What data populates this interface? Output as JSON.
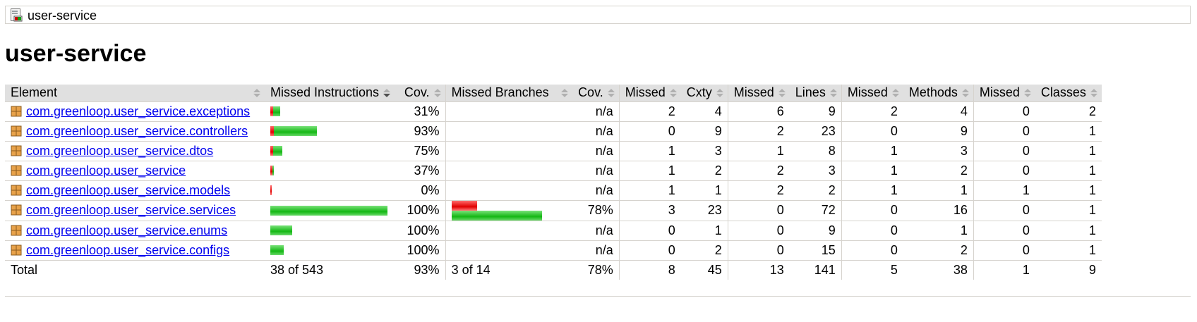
{
  "breadcrumb": {
    "label": "user-service",
    "icon": "report-icon"
  },
  "page_title": "user-service",
  "table": {
    "headers": [
      "Element",
      "Missed Instructions",
      "Cov.",
      "Missed Branches",
      "Cov.",
      "Missed",
      "Cxty",
      "Missed",
      "Lines",
      "Missed",
      "Methods",
      "Missed",
      "Classes"
    ],
    "rows": [
      {
        "name": "com.greenloop.user_service.exceptions",
        "instr_missed_frac": 0.31,
        "instr_cov": "31%",
        "branch_cov": "n/a",
        "cxty_missed": "2",
        "cxty": "4",
        "lines_missed": "6",
        "lines": "9",
        "methods_missed": "2",
        "methods": "4",
        "classes_missed": "0",
        "classes": "2"
      },
      {
        "name": "com.greenloop.user_service.controllers",
        "instr_missed_frac": 0.07,
        "instr_cov": "93%",
        "branch_cov": "n/a",
        "cxty_missed": "0",
        "cxty": "9",
        "lines_missed": "2",
        "lines": "23",
        "methods_missed": "0",
        "methods": "9",
        "classes_missed": "0",
        "classes": "1"
      },
      {
        "name": "com.greenloop.user_service.dtos",
        "instr_missed_frac": 0.25,
        "instr_cov": "75%",
        "branch_cov": "n/a",
        "cxty_missed": "1",
        "cxty": "3",
        "lines_missed": "1",
        "lines": "8",
        "methods_missed": "1",
        "methods": "3",
        "classes_missed": "0",
        "classes": "1"
      },
      {
        "name": "com.greenloop.user_service",
        "instr_missed_frac": 0.63,
        "instr_cov": "37%",
        "branch_cov": "n/a",
        "cxty_missed": "1",
        "cxty": "2",
        "lines_missed": "2",
        "lines": "3",
        "methods_missed": "1",
        "methods": "2",
        "classes_missed": "0",
        "classes": "1"
      },
      {
        "name": "com.greenloop.user_service.models",
        "instr_missed_frac": 1.0,
        "instr_cov": "0%",
        "branch_cov": "n/a",
        "cxty_missed": "1",
        "cxty": "1",
        "lines_missed": "2",
        "lines": "2",
        "methods_missed": "1",
        "methods": "1",
        "classes_missed": "1",
        "classes": "1"
      },
      {
        "name": "com.greenloop.user_service.services",
        "instr_missed_frac": 0.0,
        "instr_cov": "100%",
        "branch_missed_frac": 0.22,
        "branch_cov": "78%",
        "cxty_missed": "3",
        "cxty": "23",
        "lines_missed": "0",
        "lines": "72",
        "methods_missed": "0",
        "methods": "16",
        "classes_missed": "0",
        "classes": "1"
      },
      {
        "name": "com.greenloop.user_service.enums",
        "instr_missed_frac": 0.0,
        "instr_cov": "100%",
        "branch_cov": "n/a",
        "cxty_missed": "0",
        "cxty": "1",
        "lines_missed": "0",
        "lines": "9",
        "methods_missed": "0",
        "methods": "1",
        "classes_missed": "0",
        "classes": "1"
      },
      {
        "name": "com.greenloop.user_service.configs",
        "instr_missed_frac": 0.0,
        "instr_cov": "100%",
        "branch_cov": "n/a",
        "cxty_missed": "0",
        "cxty": "2",
        "lines_missed": "0",
        "lines": "15",
        "methods_missed": "0",
        "methods": "2",
        "classes_missed": "0",
        "classes": "1"
      }
    ],
    "total": {
      "label": "Total",
      "instr": "38 of 543",
      "instr_cov": "93%",
      "branch": "3 of 14",
      "branch_cov": "78%",
      "cxty_missed": "8",
      "cxty": "45",
      "lines_missed": "13",
      "lines": "141",
      "methods_missed": "5",
      "methods": "38",
      "classes_missed": "1",
      "classes": "9"
    }
  },
  "colors": {
    "covered": "#14b814",
    "missed": "#e00000",
    "link": "#0000ee",
    "header_bg": "#e0e0e0"
  }
}
